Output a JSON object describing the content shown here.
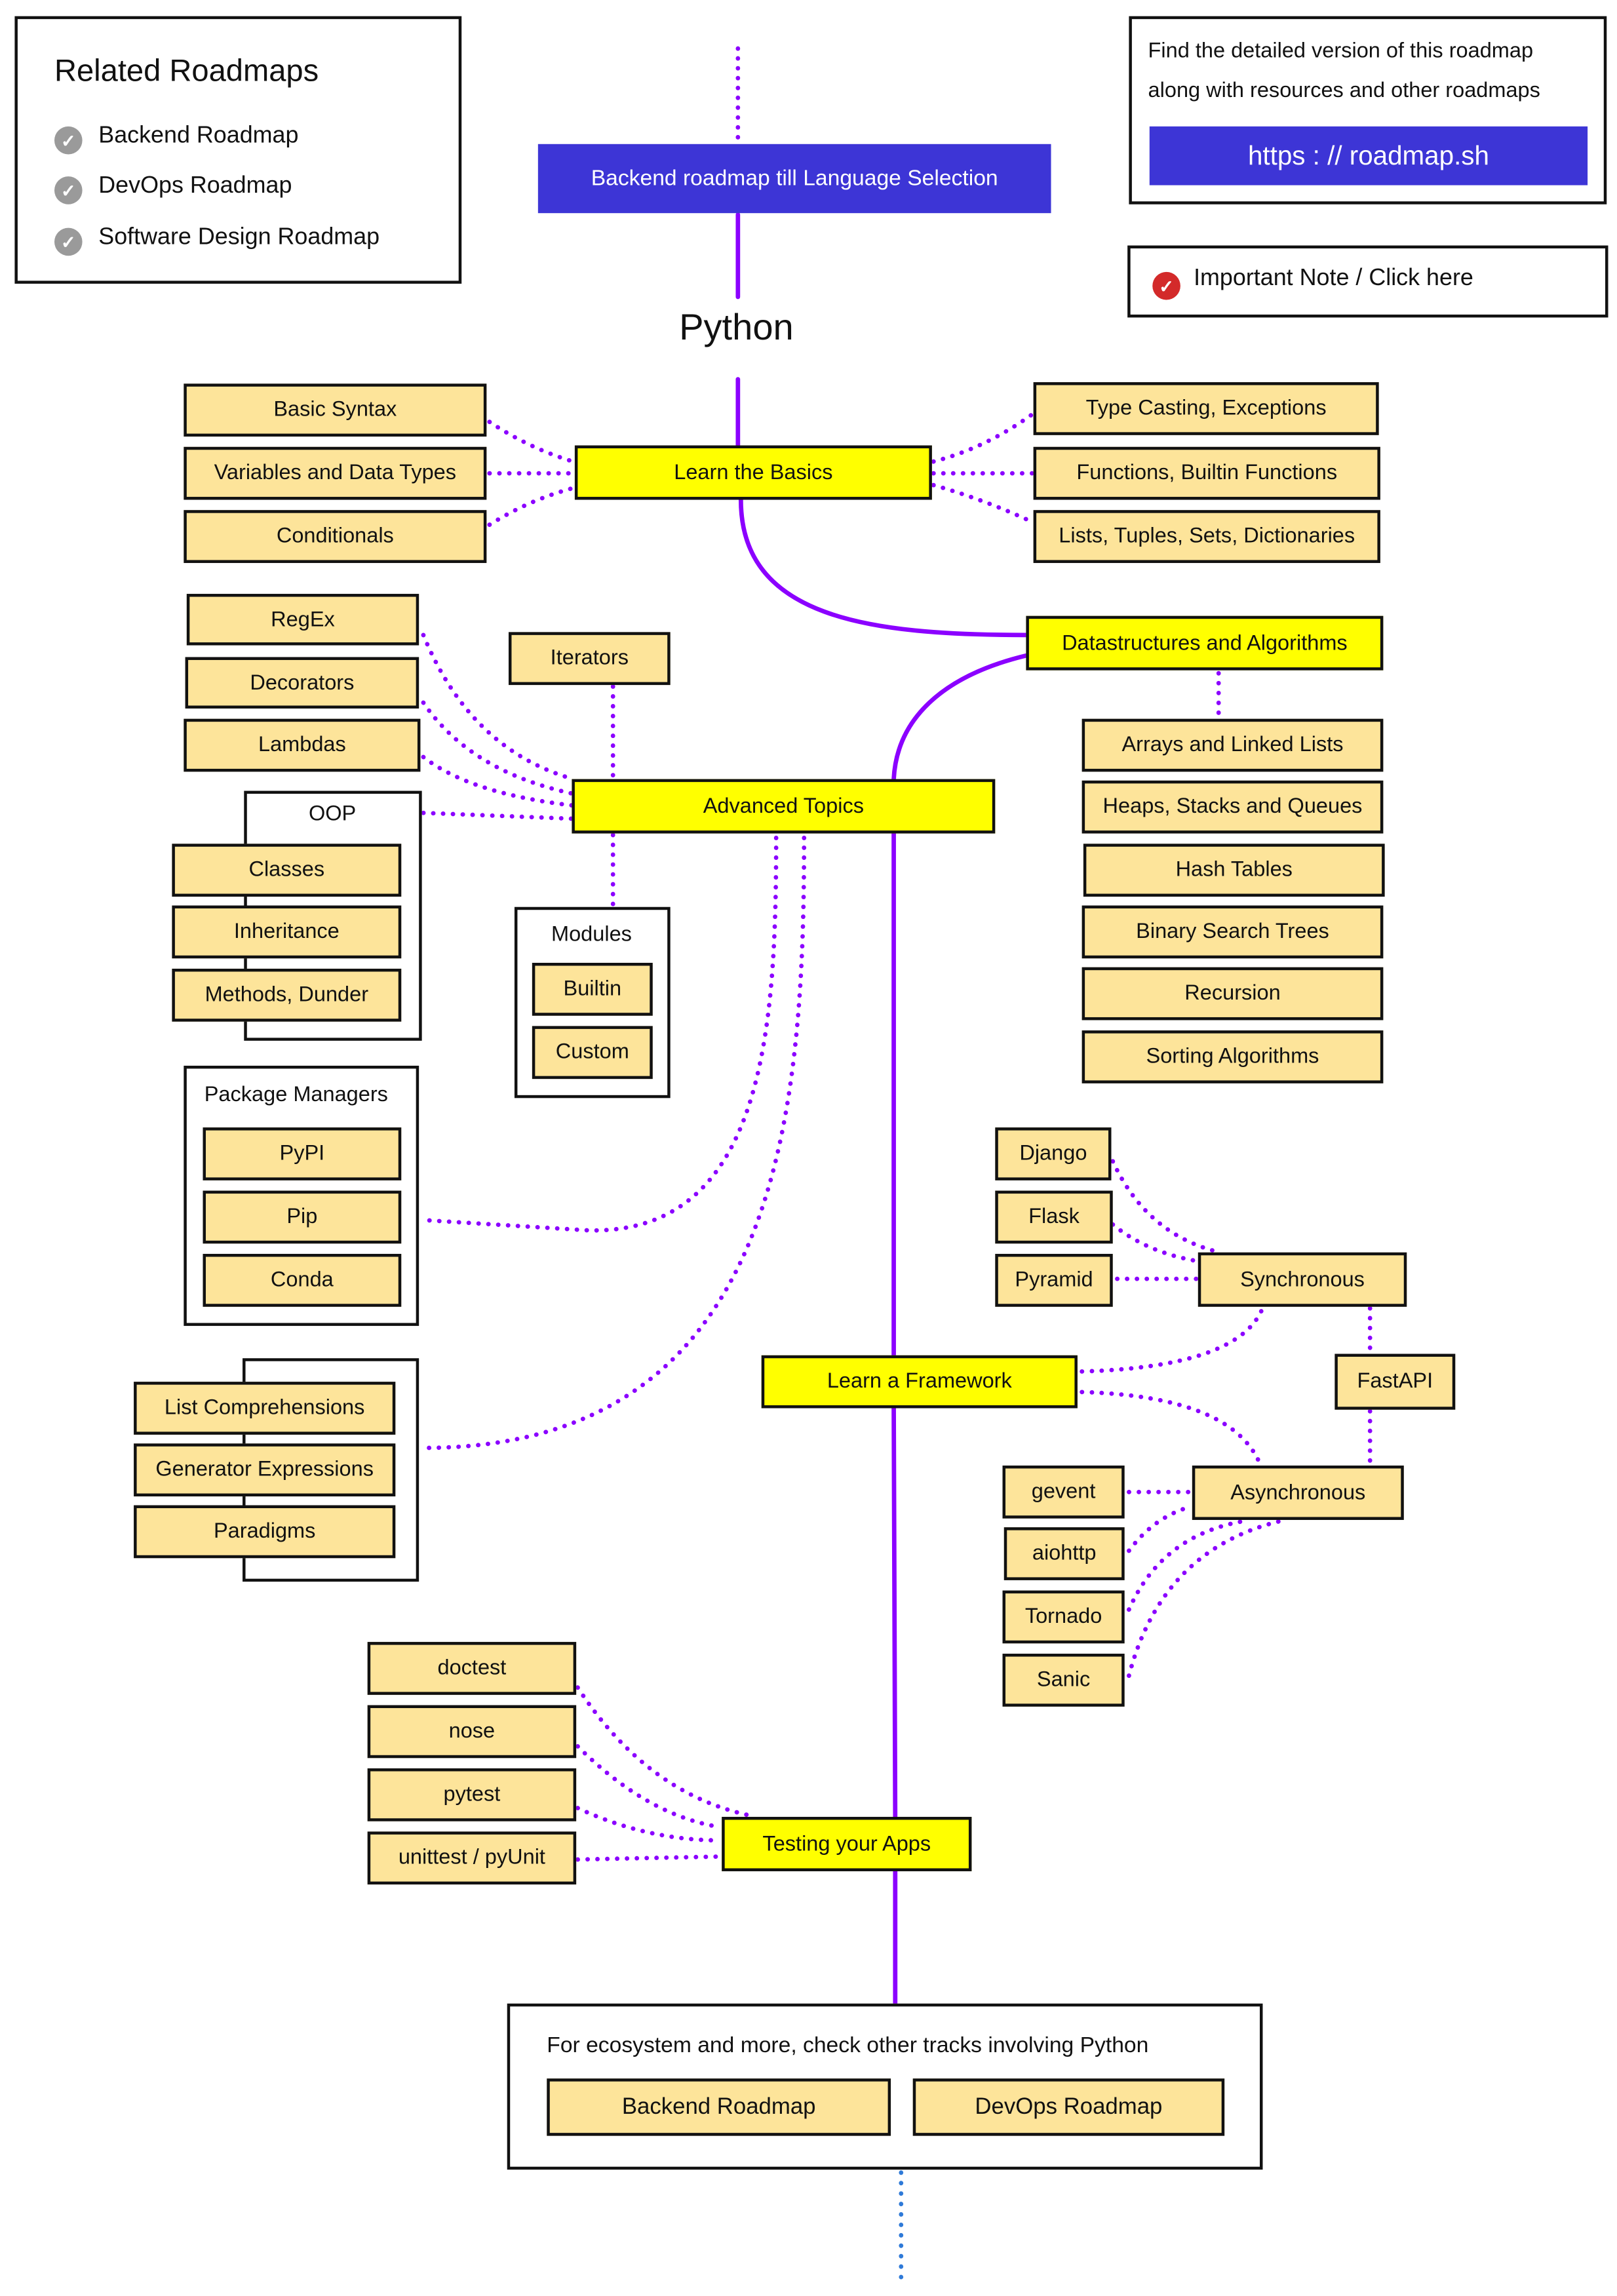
{
  "colors": {
    "link": "#8b00ff",
    "main_topic": "#ffff00",
    "subtopic": "#fde49a",
    "accent_button": "#3d35d6",
    "continuation_dots": "#2f7ad8",
    "related_check": "#9a9a9a",
    "note_check": "#d32a2a"
  },
  "related": {
    "title": "Related Roadmaps",
    "items": [
      {
        "label": "Backend Roadmap",
        "icon": "check-circle-icon"
      },
      {
        "label": "DevOps Roadmap",
        "icon": "check-circle-icon"
      },
      {
        "label": "Software Design Roadmap",
        "icon": "check-circle-icon"
      }
    ]
  },
  "detailed": {
    "line1": "Find the detailed version of this roadmap",
    "line2": "along with resources and other roadmaps",
    "link_label": "https : // roadmap.sh"
  },
  "note": {
    "label": "Important Note / Click here",
    "icon": "check-circle-icon"
  },
  "header": {
    "banner": "Backend roadmap till Language Selection",
    "title": "Python"
  },
  "basics": {
    "title": "Learn the Basics",
    "left": [
      "Basic Syntax",
      "Variables and Data Types",
      "Conditionals"
    ],
    "right": [
      "Type Casting, Exceptions",
      "Functions, Builtin Functions",
      "Lists, Tuples, Sets, Dictionaries"
    ]
  },
  "dsa": {
    "title": "Datastructures and Algorithms",
    "items": [
      "Arrays and Linked Lists",
      "Heaps, Stacks and Queues",
      "Hash Tables",
      "Binary Search Trees",
      "Recursion",
      "Sorting Algorithms"
    ]
  },
  "advanced": {
    "title": "Advanced Topics",
    "left": [
      "RegEx",
      "Decorators",
      "Lambdas"
    ],
    "iterators": "Iterators",
    "oop": {
      "title": "OOP",
      "items": [
        "Classes",
        "Inheritance",
        "Methods, Dunder"
      ]
    },
    "modules": {
      "title": "Modules",
      "items": [
        "Builtin",
        "Custom"
      ]
    },
    "package_managers": {
      "title": "Package Managers",
      "items": [
        "PyPI",
        "Pip",
        "Conda"
      ]
    },
    "comprehensions": [
      "List Comprehensions",
      "Generator Expressions",
      "Paradigms"
    ]
  },
  "framework": {
    "title": "Learn a Framework",
    "sync": {
      "title": "Synchronous",
      "items": [
        "Django",
        "Flask",
        "Pyramid"
      ]
    },
    "fastapi": "FastAPI",
    "async": {
      "title": "Asynchronous",
      "items": [
        "gevent",
        "aiohttp",
        "Tornado",
        "Sanic"
      ]
    }
  },
  "testing": {
    "title": "Testing your Apps",
    "items": [
      "doctest",
      "nose",
      "pytest",
      "unittest / pyUnit"
    ]
  },
  "footer": {
    "text": "For ecosystem and more, check other tracks involving Python",
    "buttons": [
      "Backend Roadmap",
      "DevOps Roadmap"
    ]
  }
}
